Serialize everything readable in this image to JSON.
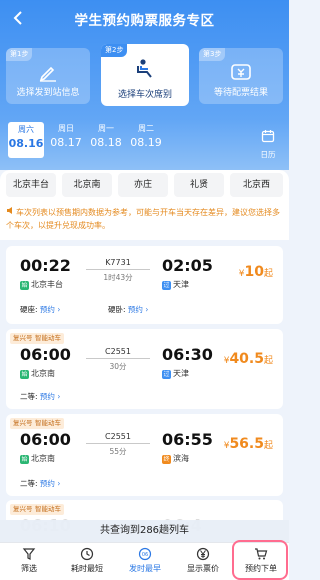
{
  "header": {
    "title": "学生预约购票服务专区",
    "back_icon": "back-arrow-icon"
  },
  "steps": [
    {
      "no": "第1步",
      "label": "选择发到站信息",
      "icon": "pen-icon",
      "active": false
    },
    {
      "no": "第2步",
      "label": "选择车次席别",
      "icon": "seat-icon",
      "active": true
    },
    {
      "no": "第3步",
      "label": "等待配票结果",
      "icon": "ticket-icon",
      "active": false
    }
  ],
  "dates": [
    {
      "weekday": "周六",
      "date": "08.16",
      "selected": true
    },
    {
      "weekday": "周日",
      "date": "08.17",
      "selected": false
    },
    {
      "weekday": "周一",
      "date": "08.18",
      "selected": false
    },
    {
      "weekday": "周二",
      "date": "08.19",
      "selected": false
    }
  ],
  "calendar_label": "日历",
  "stations": [
    "北京丰台",
    "北京南",
    "亦庄",
    "礼贤",
    "北京西"
  ],
  "notice": "车次列表以预售期内数据为参考，可能与开车当天存在差异，建议您选择多个车次，以提升兑现成功率。",
  "trains": [
    {
      "tags": [],
      "dep_time": "00:22",
      "dep_station": "北京丰台",
      "dep_badge": "始",
      "train_no": "K7731",
      "duration": "1时43分",
      "arr_time": "02:05",
      "arr_station": "天津",
      "arr_badge": "过",
      "price": "10",
      "price_unit": "起",
      "seats": [
        {
          "name": "硬座:",
          "action": "预约"
        },
        {
          "name": "硬卧:",
          "action": "预约"
        }
      ]
    },
    {
      "tags": [
        "复兴号",
        "智能动车"
      ],
      "dep_time": "06:00",
      "dep_station": "北京南",
      "dep_badge": "始",
      "train_no": "C2551",
      "duration": "30分",
      "arr_time": "06:30",
      "arr_station": "天津",
      "arr_badge": "过",
      "price": "40.5",
      "price_unit": "起",
      "seats": [
        {
          "name": "二等:",
          "action": "预约"
        }
      ]
    },
    {
      "tags": [
        "复兴号",
        "智能动车"
      ],
      "dep_time": "06:00",
      "dep_station": "北京南",
      "dep_badge": "始",
      "train_no": "C2551",
      "duration": "55分",
      "arr_time": "06:55",
      "arr_station": "滨海",
      "arr_badge": "终",
      "price": "56.5",
      "price_unit": "起",
      "seats": [
        {
          "name": "二等:",
          "action": "预约"
        }
      ]
    },
    {
      "tags": [
        "复兴号",
        "智能动车"
      ],
      "dep_time": "06:10",
      "dep_station": "",
      "dep_badge": "",
      "train_no": "",
      "duration": "",
      "arr_time": "06:4",
      "arr_station": "",
      "arr_badge": "",
      "price": "",
      "price_unit": "",
      "seats": []
    }
  ],
  "summary": "共查询到286趟列车",
  "tabbar": [
    {
      "label": "筛选",
      "icon": "filter-icon",
      "active": false
    },
    {
      "label": "耗时最短",
      "icon": "clock-icon",
      "active": false
    },
    {
      "label": "发时最早",
      "icon": "early-icon",
      "active": true
    },
    {
      "label": "显示票价",
      "icon": "yen-icon",
      "active": false
    },
    {
      "label": "预约下单",
      "icon": "cart-icon",
      "active": false
    }
  ],
  "colors": {
    "primary": "#3d8ff2",
    "accent_price": "#f08a1e",
    "highlight": "#ff6c8f"
  }
}
